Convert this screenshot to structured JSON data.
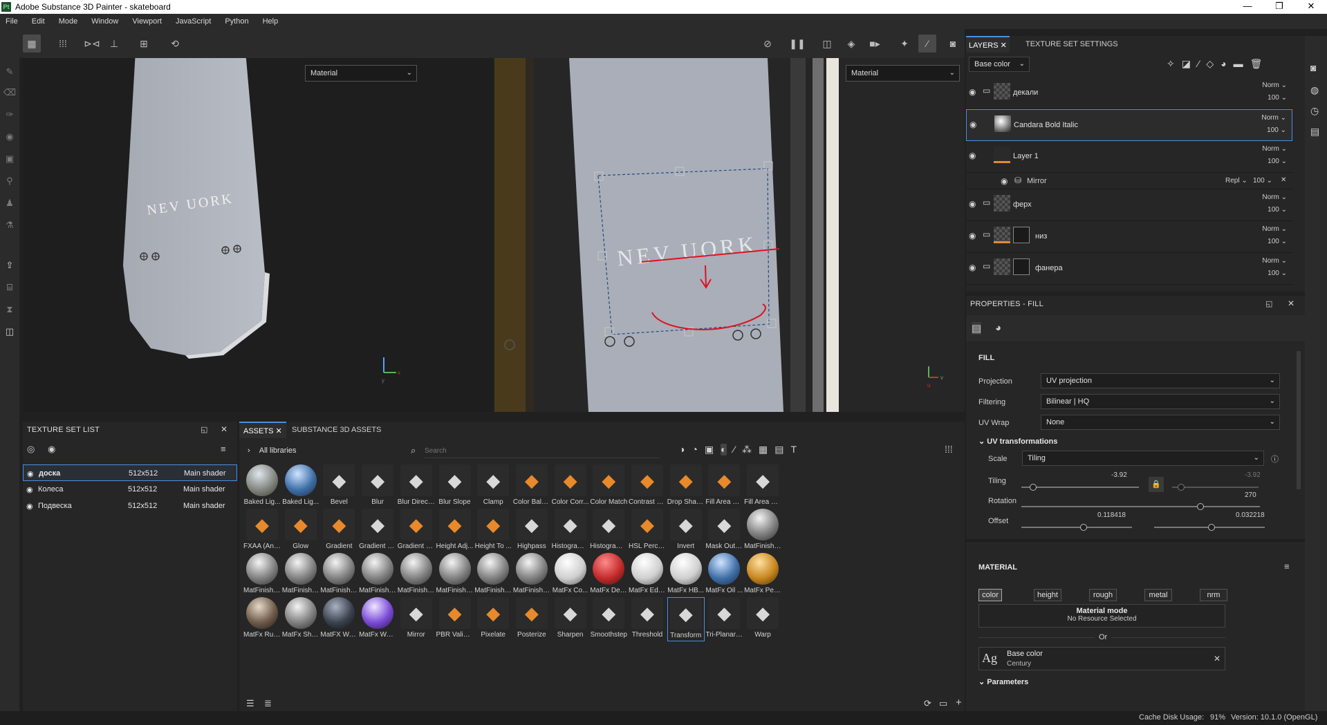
{
  "window": {
    "title": "Adobe Substance 3D Painter - skateboard",
    "app_badge": "Pt",
    "controls": [
      "—",
      "❐",
      "✕"
    ]
  },
  "menu": [
    "File",
    "Edit",
    "Mode",
    "Window",
    "Viewport",
    "JavaScript",
    "Python",
    "Help"
  ],
  "viewports": {
    "left_select": "Material",
    "right_select": "Material",
    "board_text": "NEV UORK",
    "axis_left": {
      "x": "x",
      "y": "y"
    },
    "axis_right": {
      "x": "v",
      "y": "u"
    }
  },
  "texture_set_list": {
    "title": "TEXTURE SET LIST",
    "rows": [
      {
        "name": "доска",
        "res": "512x512",
        "shader": "Main shader"
      },
      {
        "name": "Колеса",
        "res": "512x512",
        "shader": "Main shader"
      },
      {
        "name": "Подвеска",
        "res": "512x512",
        "shader": "Main shader"
      }
    ]
  },
  "assets": {
    "tabs": [
      "ASSETS",
      "SUBSTANCE 3D ASSETS"
    ],
    "library": "All libraries",
    "search_placeholder": "Search",
    "items": [
      {
        "label": "Baked Lig...",
        "kind": "sphere-env"
      },
      {
        "label": "Baked Lig...",
        "kind": "sphere-blue"
      },
      {
        "label": "Bevel",
        "kind": "icon-grey"
      },
      {
        "label": "Blur",
        "kind": "icon-grey"
      },
      {
        "label": "Blur Directi...",
        "kind": "icon-grey"
      },
      {
        "label": "Blur Slope",
        "kind": "icon-grey"
      },
      {
        "label": "Clamp",
        "kind": "icon-grey"
      },
      {
        "label": "Color Bala...",
        "kind": "icon-orange"
      },
      {
        "label": "Color Corr...",
        "kind": "icon-orange"
      },
      {
        "label": "Color Match",
        "kind": "icon-orange"
      },
      {
        "label": "Contrast L...",
        "kind": "icon-orange"
      },
      {
        "label": "Drop Shad...",
        "kind": "icon-orange"
      },
      {
        "label": "Fill Area Co...",
        "kind": "icon-orange"
      },
      {
        "label": "Fill Area M...",
        "kind": "icon-grey"
      },
      {
        "label": "FXAA (Anti...",
        "kind": "icon-orange"
      },
      {
        "label": "Glow",
        "kind": "icon-orange"
      },
      {
        "label": "Gradient",
        "kind": "icon-orange"
      },
      {
        "label": "Gradient C...",
        "kind": "icon-grey"
      },
      {
        "label": "Gradient D...",
        "kind": "icon-orange"
      },
      {
        "label": "Height Adj...",
        "kind": "icon-orange"
      },
      {
        "label": "Height To ...",
        "kind": "icon-orange"
      },
      {
        "label": "Highpass",
        "kind": "icon-grey"
      },
      {
        "label": "Histogram ...",
        "kind": "icon-grey"
      },
      {
        "label": "Histogram ...",
        "kind": "icon-grey"
      },
      {
        "label": "HSL Perce...",
        "kind": "icon-orange"
      },
      {
        "label": "Invert",
        "kind": "icon-grey"
      },
      {
        "label": "Mask Outli...",
        "kind": "icon-grey"
      },
      {
        "label": "MatFinish ...",
        "kind": "sphere-metal"
      },
      {
        "label": "MatFinish ...",
        "kind": "sphere-metal"
      },
      {
        "label": "MatFinish ...",
        "kind": "sphere-metal"
      },
      {
        "label": "MatFinish ...",
        "kind": "sphere-metal"
      },
      {
        "label": "MatFinish ...",
        "kind": "sphere-metal"
      },
      {
        "label": "MatFinish ...",
        "kind": "sphere-metal"
      },
      {
        "label": "MatFinish ...",
        "kind": "sphere-metal"
      },
      {
        "label": "MatFinish ...",
        "kind": "sphere-metal"
      },
      {
        "label": "MatFinish ...",
        "kind": "sphere-metal"
      },
      {
        "label": "MatFx Co...",
        "kind": "sphere-white"
      },
      {
        "label": "MatFx Det...",
        "kind": "sphere-red"
      },
      {
        "label": "MatFx Edg...",
        "kind": "sphere-white"
      },
      {
        "label": "MatFx HB...",
        "kind": "sphere-white"
      },
      {
        "label": "MatFx Oil ...",
        "kind": "sphere-blue"
      },
      {
        "label": "MatFx Peel...",
        "kind": "sphere-gold"
      },
      {
        "label": "MatFx Rus...",
        "kind": "sphere-rust"
      },
      {
        "label": "MatFx Shu...",
        "kind": "sphere-metal"
      },
      {
        "label": "MatFX Wat...",
        "kind": "sphere-dark"
      },
      {
        "label": "MatFx Wat...",
        "kind": "sphere-purple"
      },
      {
        "label": "Mirror",
        "kind": "icon-grey"
      },
      {
        "label": "PBR Valida...",
        "kind": "icon-orange"
      },
      {
        "label": "Pixelate",
        "kind": "icon-orange"
      },
      {
        "label": "Posterize",
        "kind": "icon-orange"
      },
      {
        "label": "Sharpen",
        "kind": "icon-grey"
      },
      {
        "label": "Smoothstep",
        "kind": "icon-grey"
      },
      {
        "label": "Threshold",
        "kind": "icon-grey"
      },
      {
        "label": "Transform",
        "kind": "icon-grey",
        "selected": true
      },
      {
        "label": "Tri-Planar ...",
        "kind": "icon-grey"
      },
      {
        "label": "Warp",
        "kind": "icon-grey"
      }
    ]
  },
  "layers_panel": {
    "tabs": [
      "LAYERS",
      "TEXTURE SET SETTINGS"
    ],
    "channel": "Base color",
    "layers": [
      {
        "name": "декали",
        "type": "folder",
        "blend": "Norm",
        "opacity": "100"
      },
      {
        "name": "Candara Bold Italic",
        "type": "text",
        "blend": "Norm",
        "opacity": "100",
        "selected": true
      },
      {
        "name": "Layer 1",
        "type": "paint",
        "blend": "Norm",
        "opacity": "100"
      },
      {
        "name": "Mirror",
        "type": "effect",
        "blend": "Repl",
        "opacity": "100"
      },
      {
        "name": "ферх",
        "type": "folder",
        "blend": "Norm",
        "opacity": "100"
      },
      {
        "name": "низ",
        "type": "folder-mask",
        "blend": "Norm",
        "opacity": "100"
      },
      {
        "name": "фанера",
        "type": "folder-mask",
        "blend": "Norm",
        "opacity": "100"
      }
    ]
  },
  "properties": {
    "title": "PROPERTIES - FILL",
    "section": "FILL",
    "projection_label": "Projection",
    "projection": "UV projection",
    "filtering_label": "Filtering",
    "filtering": "Bilinear | HQ",
    "uvwrap_label": "UV Wrap",
    "uvwrap": "None",
    "uvt_title": "UV transformations",
    "scale_label": "Scale",
    "scale": "Tiling",
    "tiling_label": "Tiling",
    "tiling_u": "-3.92",
    "tiling_v": "-3.92",
    "tiling_fill": 0.1,
    "rotation_label": "Rotation",
    "rotation": "270",
    "rotation_fill": 0.75,
    "offset_label": "Offset",
    "offset_u": "0.118418",
    "offset_v": "0.032218",
    "offset_u_fill": 0.56,
    "offset_v_fill": 0.52,
    "material_title": "MATERIAL",
    "channels": [
      "color",
      "height",
      "rough",
      "metal",
      "nrm"
    ],
    "material_mode_label": "Material mode",
    "material_mode_value": "No Resource Selected",
    "or_label": "Or",
    "font_glyph": "Ag",
    "font_channel": "Base color",
    "font_name": "Century",
    "parameters_label": "Parameters"
  },
  "status": {
    "cache": "Cache Disk Usage:",
    "cache_value": "91%",
    "version": "Version: 10.1.0 (OpenGL)"
  },
  "colors": {
    "accent": "#4a90e2",
    "orange": "#e8892b",
    "annotation_red": "#e0101e"
  }
}
